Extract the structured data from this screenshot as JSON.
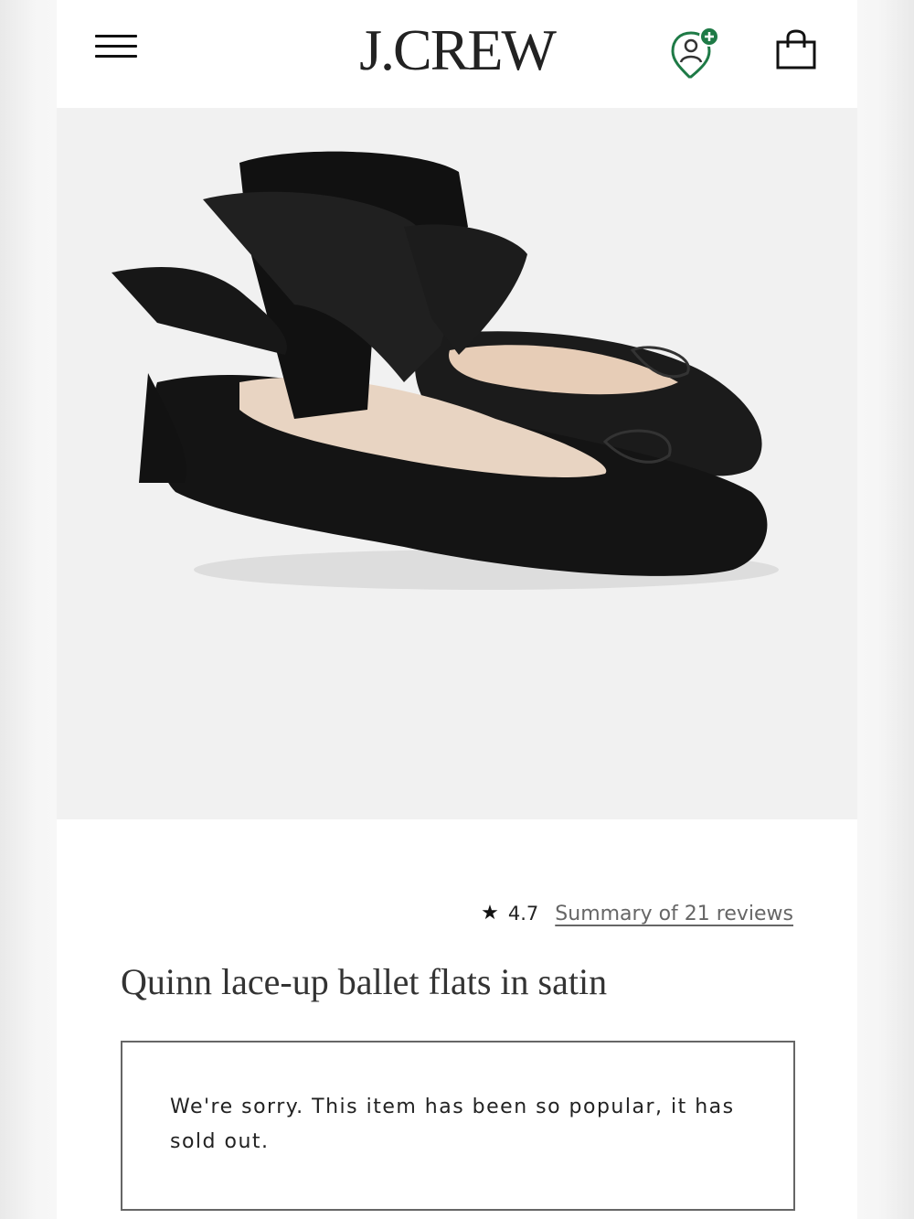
{
  "header": {
    "brand": "J.CREW",
    "menu_icon": "hamburger-menu-icon",
    "location_icon": "store-location-icon",
    "bag_icon": "shopping-bag-icon",
    "accent_color": "#1e7a46"
  },
  "product": {
    "image_alt": "Quinn lace-up ballet flats in satin",
    "rating": "4.7",
    "star_glyph": "★",
    "reviews_link": "Summary of 21 reviews",
    "title": "Quinn lace-up ballet flats in satin",
    "availability_message": "We're sorry. This item has been so popular, it has sold out."
  }
}
